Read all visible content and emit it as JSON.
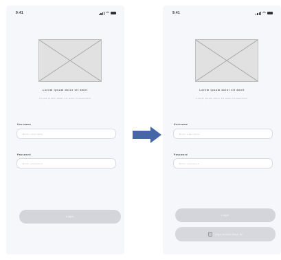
{
  "colors": {
    "phone_background": "#f6f7fb",
    "button_disabled": "#d4d5da",
    "arrow": "#4666a8",
    "placeholder_image": "#e1e1e1"
  },
  "screens": [
    {
      "status_time": "9:41",
      "heading": "Lorem ipsum dolor sit amet",
      "subheading": "Lorem ipsum dolor sit amet consectetur",
      "fields": [
        {
          "label": "Username",
          "placeholder": "Enter username"
        },
        {
          "label": "Password",
          "placeholder": "Enter password"
        }
      ],
      "login_label": "Login"
    },
    {
      "status_time": "9:41",
      "heading": "Lorem ipsum dolor sit amet",
      "subheading": "Lorem ipsum dolor sit amet consectetur",
      "fields": [
        {
          "label": "Username",
          "placeholder": "Enter username"
        },
        {
          "label": "Password",
          "placeholder": "Enter password"
        }
      ],
      "login_label": "Login",
      "faceid_label": "Sign in with Face ID",
      "faceid_icon": "face-id-icon"
    }
  ],
  "arrow": {
    "icon": "right-arrow-icon"
  }
}
